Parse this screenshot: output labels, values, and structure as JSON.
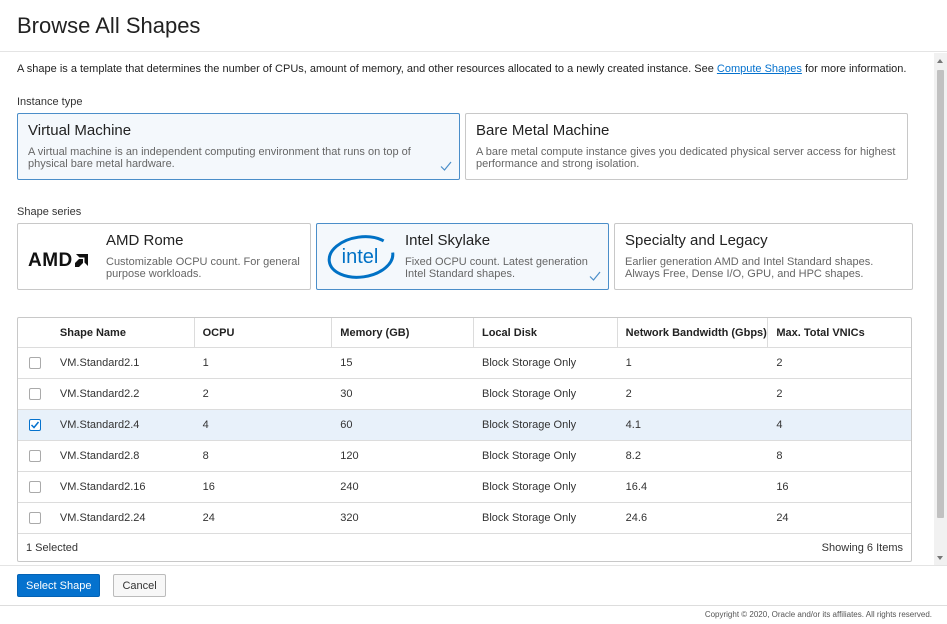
{
  "title": "Browse All Shapes",
  "intro": {
    "text_before": "A shape is a template that determines the number of CPUs, amount of memory, and other resources allocated to a newly created instance. See ",
    "link": "Compute Shapes",
    "text_after": " for more information."
  },
  "instance_type": {
    "label": "Instance type",
    "options": [
      {
        "title": "Virtual Machine",
        "desc": "A virtual machine is an independent computing environment that runs on top of physical bare metal hardware.",
        "selected": true
      },
      {
        "title": "Bare Metal Machine",
        "desc": "A bare metal compute instance gives you dedicated physical server access for highest performance and strong isolation.",
        "selected": false
      }
    ]
  },
  "shape_series": {
    "label": "Shape series",
    "options": [
      {
        "title": "AMD Rome",
        "logo_text": "AMD",
        "desc": "Customizable OCPU count. For general purpose workloads.",
        "selected": false
      },
      {
        "title": "Intel Skylake",
        "logo_text": "intel",
        "desc": "Fixed OCPU count. Latest generation Intel Standard shapes.",
        "selected": true
      },
      {
        "title": "Specialty and Legacy",
        "desc": "Earlier generation AMD and Intel Standard shapes. Always Free, Dense I/O, GPU, and HPC shapes.",
        "selected": false
      }
    ]
  },
  "table": {
    "headers": [
      "Shape Name",
      "OCPU",
      "Memory (GB)",
      "Local Disk",
      "Network Bandwidth (Gbps)",
      "Max. Total VNICs"
    ],
    "rows": [
      {
        "cells": [
          "VM.Standard2.1",
          "1",
          "15",
          "Block Storage Only",
          "1",
          "2"
        ],
        "checked": false
      },
      {
        "cells": [
          "VM.Standard2.2",
          "2",
          "30",
          "Block Storage Only",
          "2",
          "2"
        ],
        "checked": false
      },
      {
        "cells": [
          "VM.Standard2.4",
          "4",
          "60",
          "Block Storage Only",
          "4.1",
          "4"
        ],
        "checked": true
      },
      {
        "cells": [
          "VM.Standard2.8",
          "8",
          "120",
          "Block Storage Only",
          "8.2",
          "8"
        ],
        "checked": false
      },
      {
        "cells": [
          "VM.Standard2.16",
          "16",
          "240",
          "Block Storage Only",
          "16.4",
          "16"
        ],
        "checked": false
      },
      {
        "cells": [
          "VM.Standard2.24",
          "24",
          "320",
          "Block Storage Only",
          "24.6",
          "24"
        ],
        "checked": false
      }
    ],
    "footer_left": "1 Selected",
    "footer_right": "Showing 6 Items"
  },
  "actions": {
    "select": "Select Shape",
    "cancel": "Cancel"
  },
  "copyright": "Copyright © 2020, Oracle and/or its affiliates. All rights reserved.",
  "colors": {
    "accent": "#0572ce",
    "selected_border": "#4b8ec9",
    "selected_row": "#e8f1fa",
    "intel_blue": "#0071c5"
  }
}
